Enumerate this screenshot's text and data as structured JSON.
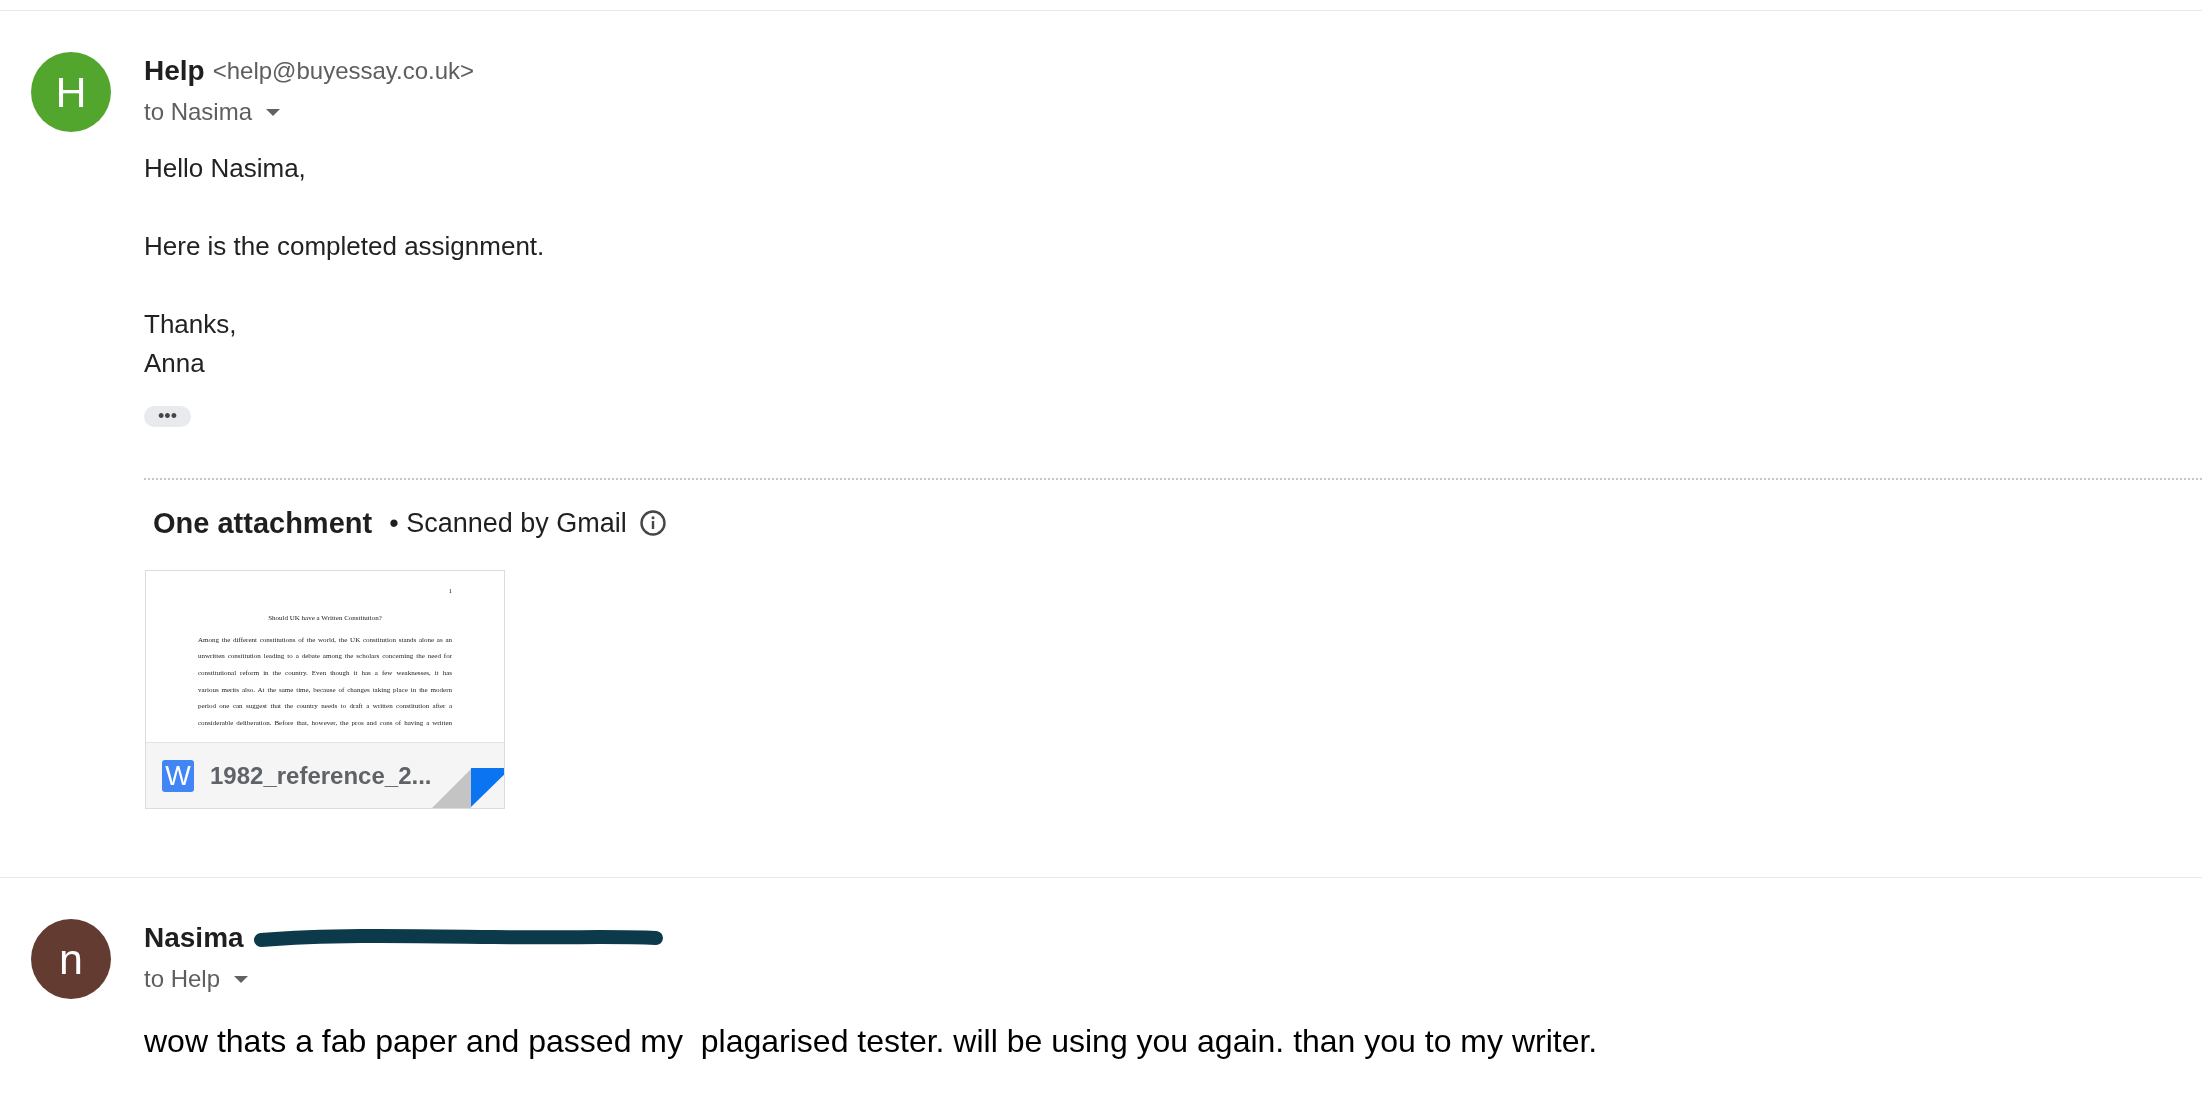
{
  "messages": [
    {
      "avatar": "H",
      "color": "#52a52d",
      "sender": "Help",
      "email": "<help@buyessay.co.uk>",
      "redacted": false,
      "recipient": "to Nasima",
      "paragraphs": [
        "Hello Nasima,",
        "Here is the completed assignment.",
        "Thanks,\nAnna"
      ],
      "trimmed_toggle": "•••",
      "attachments": {
        "heading": "One attachment",
        "scan_note": "• Scanned by Gmail",
        "files": [
          {
            "kind": "word",
            "type_label": "W",
            "name": "1982_reference_2...",
            "preview": {
              "page_number": "1",
              "title": "Should UK have a Written Constitution?",
              "lines": [
                "Among the different constitutions of the world, the UK constitution stands alone as an",
                "unwritten constitution leading to a debate among the scholars concerning the need for",
                "constitutional reform in the country. Even though it has a few weaknesses, it has",
                "various merits also. At the same time, because of changes taking place in the modern",
                "period one can suggest that the country needs to draft a written constitution after a",
                "considerable deliberation. Before that, however, the pros and cons of having a written"
              ]
            }
          }
        ]
      }
    },
    {
      "avatar": "n",
      "color": "#633b31",
      "sender": "Nasima",
      "redacted": true,
      "recipient": "to Help",
      "paragraphs": [
        "wow thats a fab paper and passed my  plagarised tester. will be using you again. than you to my writer."
      ]
    }
  ]
}
